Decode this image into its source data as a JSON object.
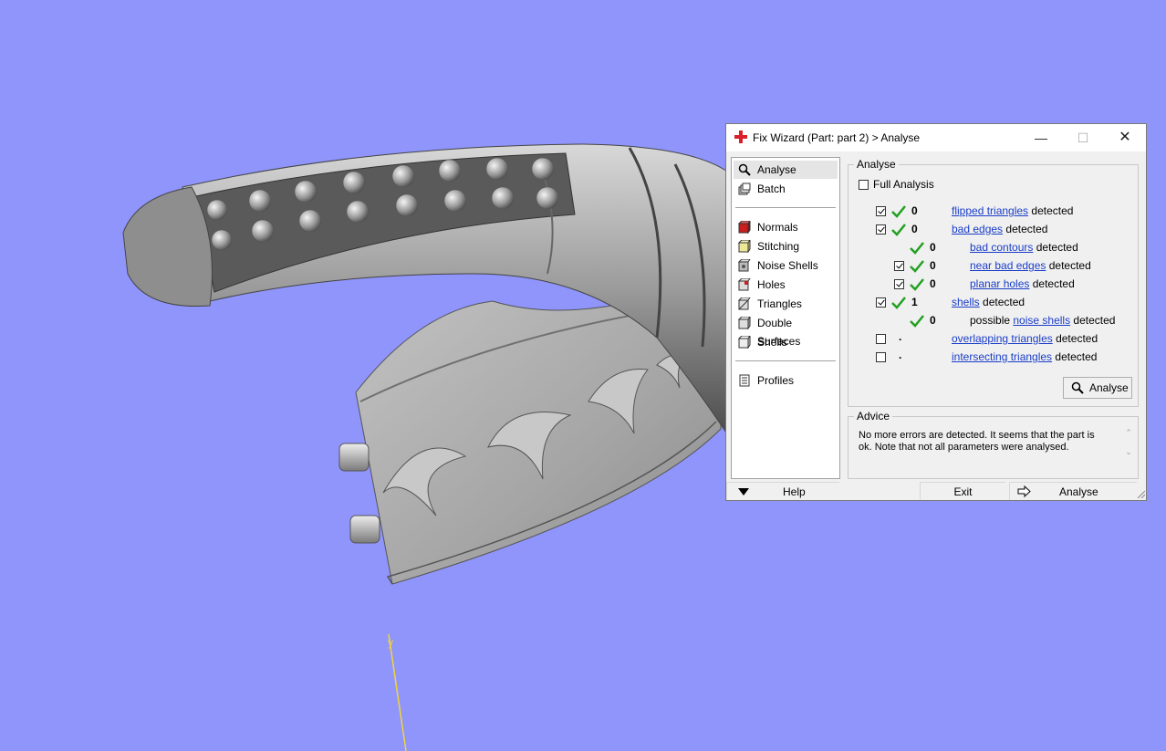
{
  "dialog": {
    "title": "Fix Wizard (Part: part 2) > Analyse",
    "nav": [
      {
        "label": "Analyse",
        "icon": "magnifier-icon",
        "selected": true
      },
      {
        "label": "Batch",
        "icon": "batch-icon"
      },
      {
        "label": "Normals",
        "icon": "normals-cube-icon"
      },
      {
        "label": "Stitching",
        "icon": "stitching-cube-icon"
      },
      {
        "label": "Noise Shells",
        "icon": "noise-shells-icon"
      },
      {
        "label": "Holes",
        "icon": "holes-cube-icon"
      },
      {
        "label": "Triangles",
        "icon": "triangles-cube-icon"
      },
      {
        "label": "Double Surfaces",
        "icon": "double-surfaces-icon"
      },
      {
        "label": "Shells",
        "icon": "shells-cube-icon"
      },
      {
        "label": "Profiles",
        "icon": "profiles-icon"
      }
    ],
    "analyse_group": {
      "title": "Analyse",
      "full_analysis_label": "Full Analysis",
      "rows": [
        {
          "count": "0",
          "link": "flipped triangles",
          "suffix": " detected"
        },
        {
          "count": "0",
          "link": "bad edges",
          "suffix": " detected"
        },
        {
          "count": "0",
          "link": "bad contours",
          "suffix": " detected"
        },
        {
          "count": "0",
          "link": "near bad edges",
          "suffix": " detected"
        },
        {
          "count": "0",
          "link": "planar holes",
          "suffix": " detected"
        },
        {
          "count": "1",
          "link": "shells",
          "suffix": " detected"
        },
        {
          "count": "0",
          "prefix": "possible ",
          "link": "noise shells",
          "suffix": " detected"
        },
        {
          "count": ".",
          "link": "overlapping triangles",
          "suffix": " detected"
        },
        {
          "count": ".",
          "link": "intersecting triangles",
          "suffix": " detected"
        }
      ],
      "analyse_button": "Analyse"
    },
    "advice_group": {
      "title": "Advice",
      "text": "No more errors are detected. It seems that the part is ok. Note that not all parameters were analysed."
    },
    "bottom": {
      "help": "Help",
      "exit": "Exit",
      "analyse": "Analyse"
    }
  },
  "viewport": {
    "background_color": "#8f95fa",
    "axis_label": "y"
  }
}
